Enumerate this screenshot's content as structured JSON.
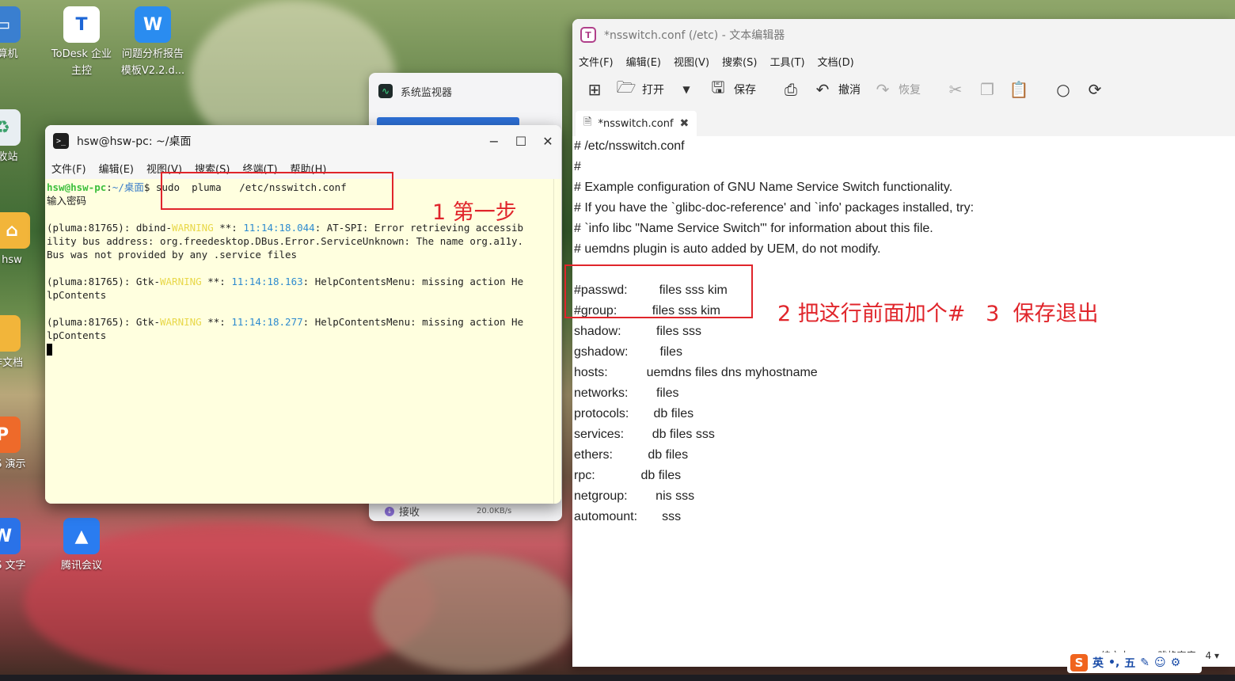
{
  "desktop": {
    "icons": [
      {
        "label": "计算机"
      },
      {
        "label": "ToDesk 企业 主控"
      },
      {
        "label": "问题分析报告 模板V2.2.d..."
      },
      {
        "label": "回收站"
      },
      {
        "label": "hsw"
      },
      {
        "label": "工作文档"
      },
      {
        "label": "WPS 演示"
      },
      {
        "label": "WPS 文字"
      },
      {
        "label": "腾讯会议"
      }
    ]
  },
  "sysmon": {
    "title": "系统监视器",
    "net_label": "接收",
    "net_speed": "20.0KB/s"
  },
  "terminal": {
    "title": "hsw@hsw-pc: ~/桌面",
    "menu": [
      "文件(F)",
      "编辑(E)",
      "视图(V)",
      "搜索(S)",
      "终端(T)",
      "帮助(H)"
    ],
    "prompt_user": "hsw@hsw-pc",
    "prompt_path": "~/桌面",
    "prompt_symbol": "$",
    "command": " sudo  pluma   /etc/nsswitch.conf",
    "password_prompt": "输入密码",
    "out1_a": "(pluma:81765): dbind-",
    "out1_warn": "WARNING",
    "out1_b": " **: ",
    "out1_time": "11:14:18.044",
    "out1_c": ": AT-SPI: Error retrieving accessib",
    "out1_l2": "ility bus address: org.freedesktop.DBus.Error.ServiceUnknown: The name org.a11y.",
    "out1_l3": "Bus was not provided by any .service files",
    "out2_a": "(pluma:81765): Gtk-",
    "out2_warn": "WARNING",
    "out2_b": " **: ",
    "out2_time": "11:14:18.163",
    "out2_c": ": HelpContentsMenu: missing action He",
    "out2_l2": "lpContents",
    "out3_a": "(pluma:81765): Gtk-",
    "out3_warn": "WARNING",
    "out3_b": " **: ",
    "out3_time": "11:14:18.277",
    "out3_c": ": HelpContentsMenu: missing action He",
    "out3_l2": "lpContents"
  },
  "editor": {
    "title": "*nsswitch.conf (/etc) - 文本编辑器",
    "menu": [
      "文件(F)",
      "编辑(E)",
      "视图(V)",
      "搜索(S)",
      "工具(T)",
      "文档(D)"
    ],
    "toolbar": {
      "open": "打开",
      "save": "保存",
      "undo": "撤消",
      "redo": "恢复"
    },
    "tab": "*nsswitch.conf",
    "lines": [
      "# /etc/nsswitch.conf",
      "#",
      "# Example configuration of GNU Name Service Switch functionality.",
      "# If you have the `glibc-doc-reference' and `info' packages installed, try:",
      "# `info libc \"Name Service Switch\"' for information about this file.",
      "# uemdns plugin is auto added by UEM, do not modify.",
      "",
      "#passwd:         files sss kim",
      "#group:          files sss kim",
      "shadow:          files sss",
      "gshadow:         files",
      "hosts:           uemdns files dns myhostname",
      "networks:        files",
      "protocols:       db files",
      "services:        db files sss",
      "ethers:          db files",
      "rpc:             db files",
      "netgroup:        nis sss",
      "automount:       sss"
    ],
    "status_type": "纯文本",
    "status_tab": "跳格宽度：4"
  },
  "annotations": {
    "step1": "1 第一步",
    "step2": "2 把这行前面加个#   3  保存退出"
  },
  "ime": {
    "logo": "S",
    "mode": "英",
    "punct": "•,",
    "layout": "五"
  }
}
